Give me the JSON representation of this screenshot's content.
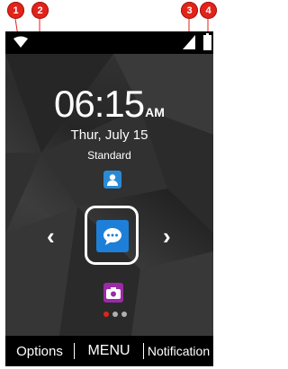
{
  "markers": [
    "1",
    "2",
    "3",
    "4"
  ],
  "status": {
    "wifi_icon": "wifi-icon",
    "signal_icon": "signal-icon",
    "battery_icon": "battery-icon"
  },
  "clock": {
    "time": "06:15",
    "ampm": "AM"
  },
  "date": "Thur, July 15",
  "profile": "Standard",
  "apps": [
    {
      "name": "contacts",
      "icon": "contact-icon",
      "color": "#2a8ad4"
    },
    {
      "name": "messages",
      "icon": "message-icon",
      "color": "#1e7fd8"
    },
    {
      "name": "camera",
      "icon": "camera-icon",
      "color": "#9a2aa6"
    }
  ],
  "softkeys": {
    "left": "Options",
    "center": "MENU",
    "right": "Notification"
  },
  "colors": {
    "marker": "#e2231a",
    "background": "#2f2f2f",
    "accent": "#1e7fd8"
  }
}
